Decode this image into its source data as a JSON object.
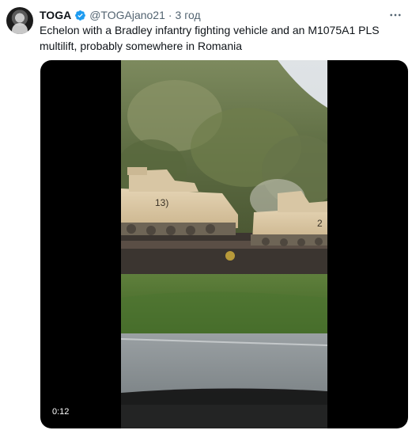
{
  "tweet": {
    "display_name": "TOGA",
    "handle": "@TOGAjano21",
    "separator": "·",
    "time": "3 год",
    "text": "Echelon with a Bradley infantry fighting vehicle and an M1075A1 PLS multilift, probably somewhere in Romania",
    "verified_icon": "verified-badge-icon",
    "more_icon": "more-horizontal-icon"
  },
  "media": {
    "type": "video",
    "duration": "0:12",
    "vehicle_markings": [
      "13)",
      "2"
    ]
  },
  "colors": {
    "verified": "#1d9bf0",
    "secondary_text": "#536471",
    "primary_text": "#0f1419"
  }
}
